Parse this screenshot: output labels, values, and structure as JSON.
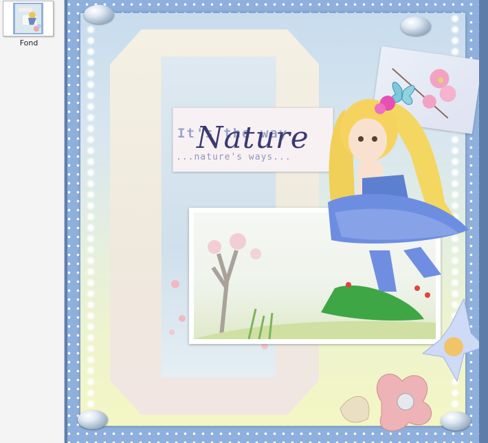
{
  "layers_panel": {
    "items": [
      {
        "label": "Fond"
      }
    ]
  },
  "canvas": {
    "title": {
      "line1": "It's the way",
      "line2": "...nature's ways...",
      "script": "Nature"
    }
  },
  "colors": {
    "frame": "#8fb0dc",
    "panel_bg": "#f4f4f4",
    "title_script": "#3a3a72"
  }
}
